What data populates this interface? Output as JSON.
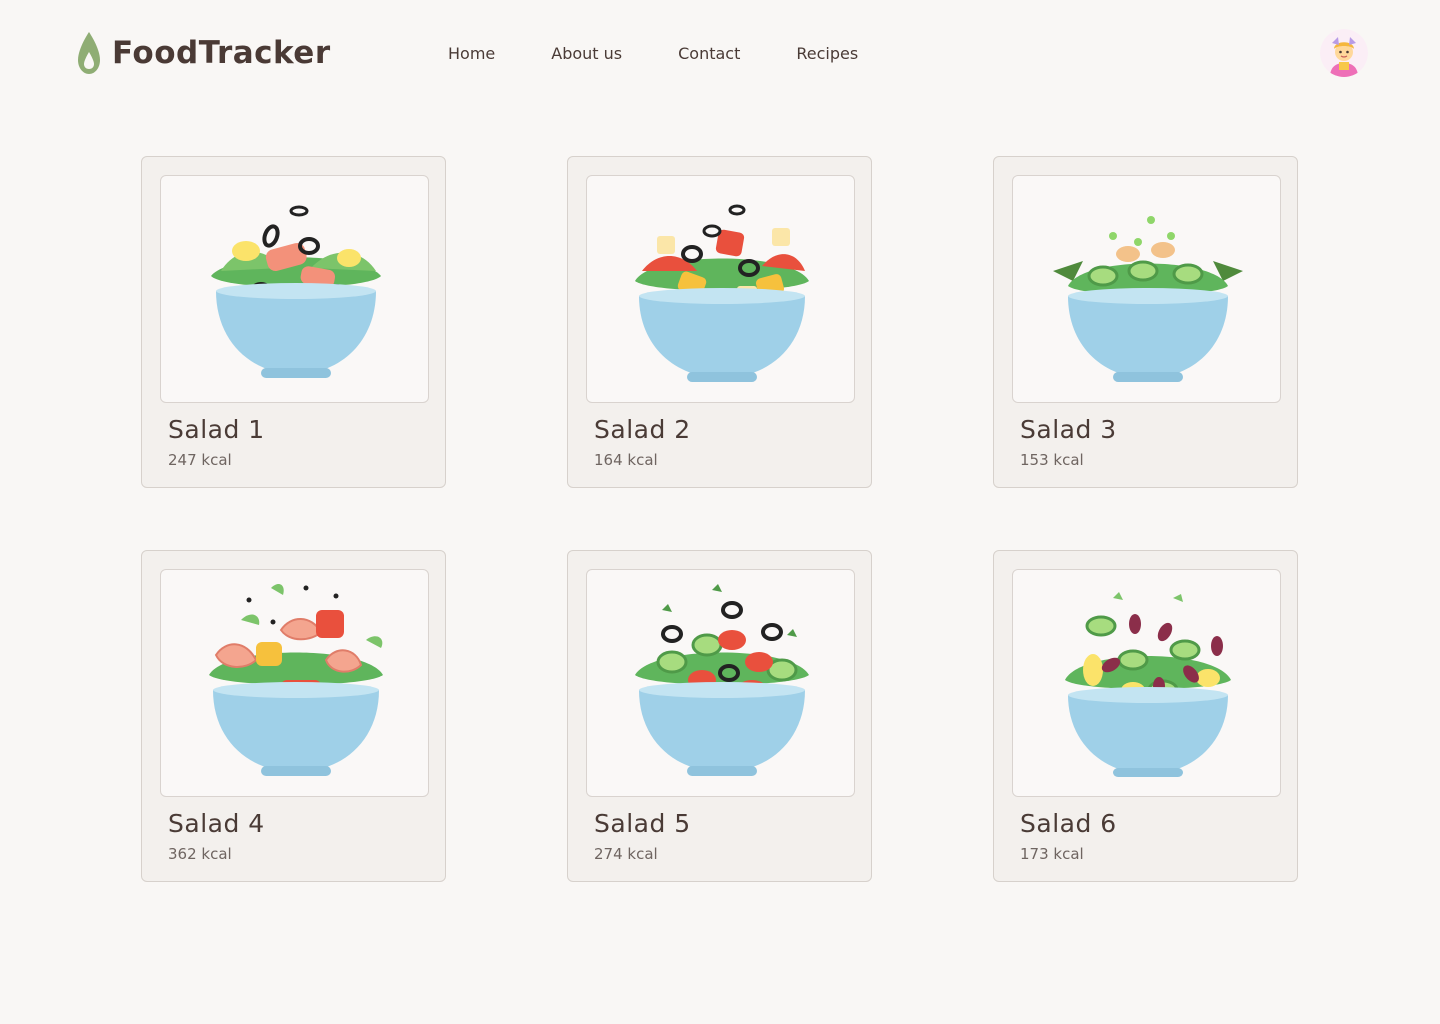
{
  "brand": {
    "name": "FoodTracker",
    "icon": "drop-icon",
    "color": "#8fad74"
  },
  "nav": {
    "items": [
      {
        "label": "Home"
      },
      {
        "label": "About us"
      },
      {
        "label": "Contact"
      },
      {
        "label": "Recipes"
      }
    ]
  },
  "user": {
    "avatar": "user-avatar"
  },
  "recipes": [
    {
      "title": "Salad 1",
      "kcal": "247 kcal",
      "image": "salad-bowl-salmon-olives"
    },
    {
      "title": "Salad 2",
      "kcal": "164 kcal",
      "image": "salad-bowl-peppers-cheese"
    },
    {
      "title": "Salad 3",
      "kcal": "153 kcal",
      "image": "salad-bowl-cucumber-herbs"
    },
    {
      "title": "Salad 4",
      "kcal": "362 kcal",
      "image": "salad-bowl-shrimp-peppers"
    },
    {
      "title": "Salad 5",
      "kcal": "274 kcal",
      "image": "salad-bowl-tomato-olives"
    },
    {
      "title": "Salad 6",
      "kcal": "173 kcal",
      "image": "salad-bowl-beans-eggs"
    }
  ],
  "colors": {
    "background": "#f9f7f5",
    "card": "#f3f0ed",
    "bowl": "#9fd0e8",
    "text": "#4a3b36"
  }
}
